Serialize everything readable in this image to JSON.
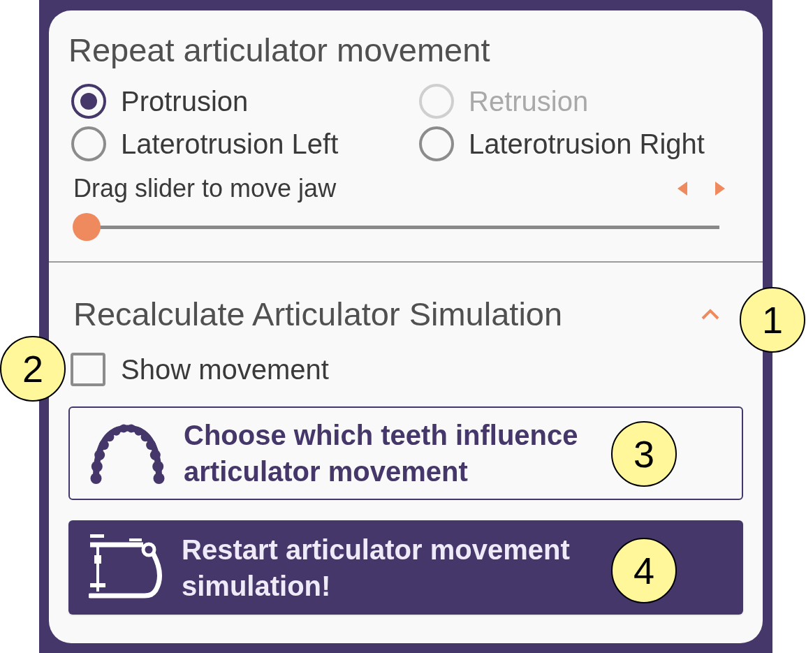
{
  "repeat_section": {
    "title": "Repeat articulator movement",
    "movements": [
      {
        "label": "Protrusion",
        "selected": true,
        "disabled": false
      },
      {
        "label": "Retrusion",
        "selected": false,
        "disabled": true
      },
      {
        "label": "Laterotrusion Left",
        "selected": false,
        "disabled": false
      },
      {
        "label": "Laterotrusion Right",
        "selected": false,
        "disabled": false
      }
    ],
    "slider": {
      "label": "Drag slider to move jaw",
      "level": 0
    }
  },
  "recalculate_section": {
    "title": "Recalculate Articulator Simulation",
    "expanded": true,
    "show_movement": {
      "label": "Show movement",
      "checked": false
    },
    "buttons": [
      {
        "kind": "outline",
        "label": "Choose which teeth influence articulator movement"
      },
      {
        "kind": "primary",
        "label": "Restart articulator movement simulation!"
      }
    ]
  },
  "callouts": [
    {
      "label": "1"
    },
    {
      "label": "2"
    },
    {
      "label": "3"
    },
    {
      "label": "4"
    }
  ]
}
